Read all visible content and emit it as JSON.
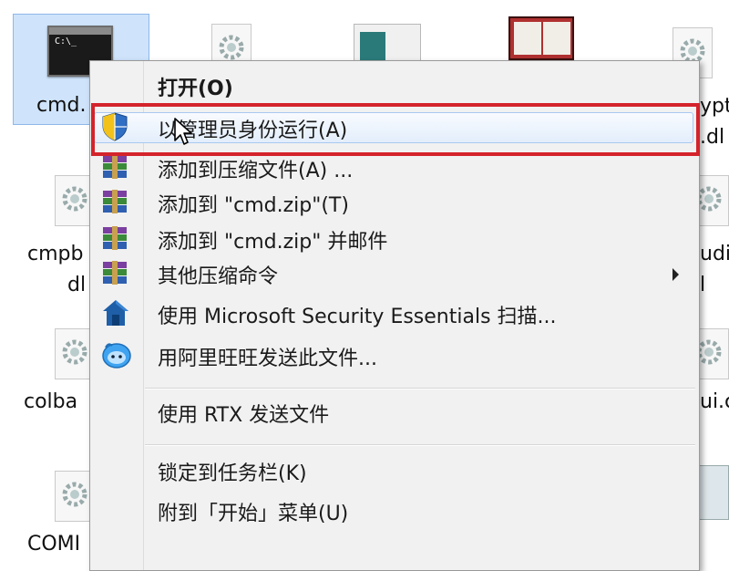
{
  "desktop": {
    "icons": [
      {
        "label": "cmd."
      },
      {
        "label": "cmpb"
      },
      {
        "label": "dl"
      },
      {
        "label": "colba"
      },
      {
        "label": "COMI"
      },
      {
        "label": "ypt"
      },
      {
        "label": ".dl"
      },
      {
        "label": "udit"
      },
      {
        "label": "l"
      },
      {
        "label": "ui.c"
      }
    ],
    "cmd_prompt_text": "C:\\_"
  },
  "context_menu": {
    "items": [
      {
        "label": "打开(O)",
        "icon": "none"
      },
      {
        "label": "以管理员身份运行(A)",
        "icon": "uac-shield-icon"
      },
      {
        "label": "添加到压缩文件(A) ...",
        "icon": "winrar-icon"
      },
      {
        "label": "添加到 \"cmd.zip\"(T)",
        "icon": "winrar-icon"
      },
      {
        "label": "添加到 \"cmd.zip\" 并邮件",
        "icon": "winrar-icon"
      },
      {
        "label": "其他压缩命令",
        "icon": "winrar-icon"
      },
      {
        "label": "使用 Microsoft Security Essentials 扫描...",
        "icon": "mse-house-icon"
      },
      {
        "label": "用阿里旺旺发送此文件...",
        "icon": "aliwangwang-icon"
      },
      {
        "label": "使用 RTX 发送文件",
        "icon": "none"
      },
      {
        "label": "锁定到任务栏(K)",
        "icon": "none"
      },
      {
        "label": "附到「开始」菜单(U)",
        "icon": "none"
      }
    ]
  },
  "colors": {
    "highlight_outline": "#d4232b",
    "hover_border": "#a8c8ef",
    "selection_bg": "#cfe4fb"
  }
}
